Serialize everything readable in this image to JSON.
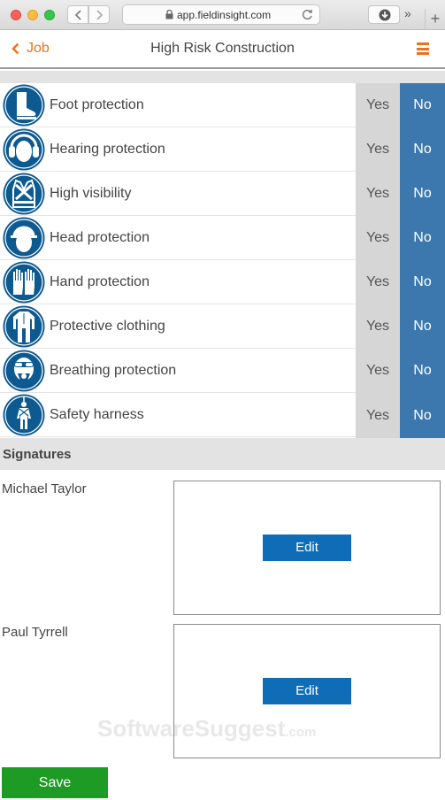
{
  "browser": {
    "url": "app.fieldinsight.com",
    "more_glyph": "»",
    "new_tab_glyph": "+"
  },
  "header": {
    "back_label": "Job",
    "title": "High Risk Construction",
    "accent_color": "#e8731d"
  },
  "ppe": {
    "yes_label": "Yes",
    "no_label": "No",
    "selected": "No",
    "items": [
      {
        "label": "Foot protection",
        "icon": "boot-icon"
      },
      {
        "label": "Hearing protection",
        "icon": "ear-muffs-icon"
      },
      {
        "label": "High visibility",
        "icon": "hi-vis-vest-icon"
      },
      {
        "label": "Head protection",
        "icon": "hard-hat-icon"
      },
      {
        "label": "Hand protection",
        "icon": "gloves-icon"
      },
      {
        "label": "Protective clothing",
        "icon": "coverall-icon"
      },
      {
        "label": "Breathing protection",
        "icon": "respirator-icon"
      },
      {
        "label": "Safety harness",
        "icon": "harness-icon"
      }
    ]
  },
  "signatures": {
    "heading": "Signatures",
    "edit_label": "Edit",
    "people": [
      {
        "name": "Michael Taylor"
      },
      {
        "name": "Paul Tyrrell"
      }
    ]
  },
  "watermark": {
    "brand": "SoftwareSuggest",
    "suffix": ".com"
  },
  "footer": {
    "save_label": "Save"
  }
}
